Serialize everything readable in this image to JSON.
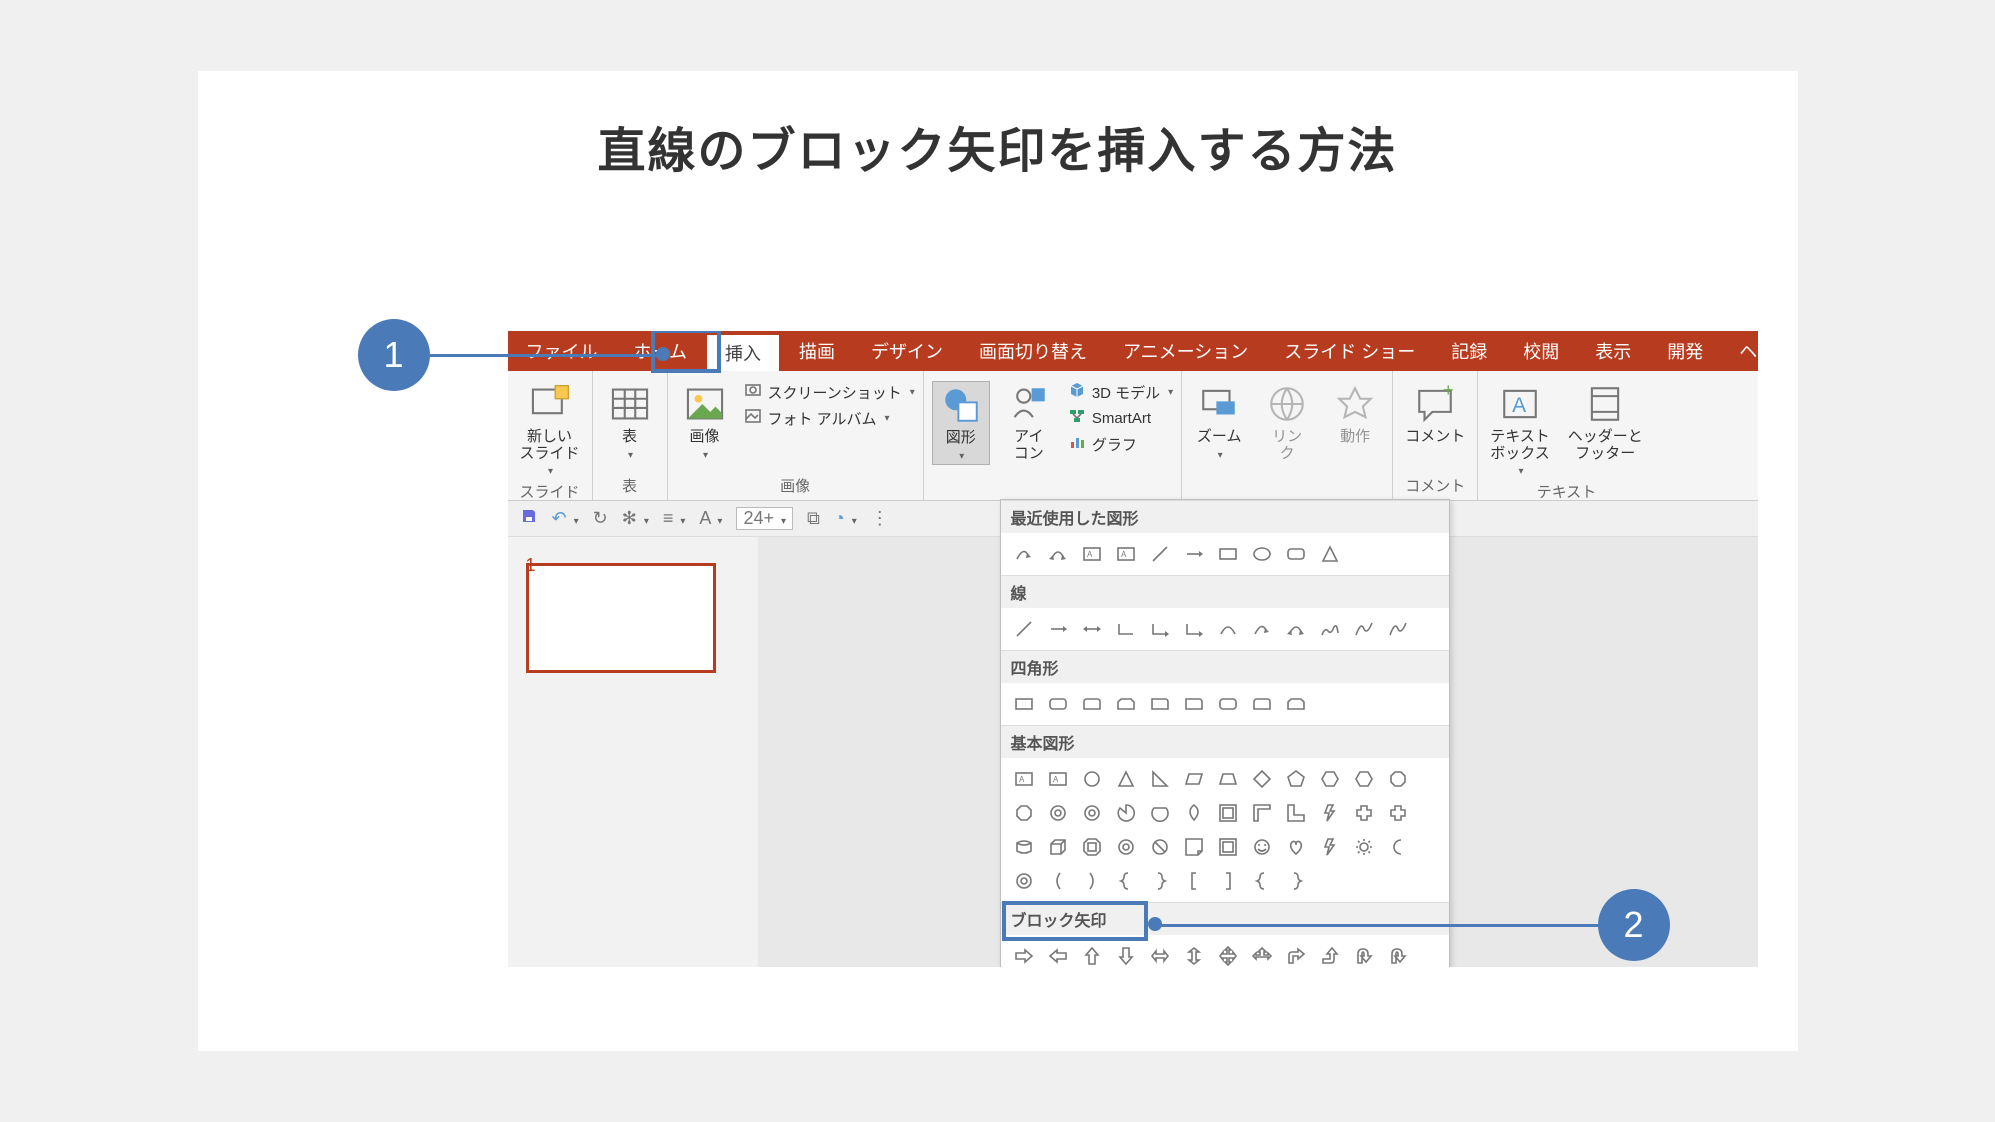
{
  "page_title": "直線のブロック矢印を挿入する方法",
  "callouts": {
    "one": "1",
    "two": "2"
  },
  "tabs": {
    "file": "ファイル",
    "home": "ホーム",
    "insert": "挿入",
    "draw": "描画",
    "design": "デザイン",
    "transitions": "画面切り替え",
    "animations": "アニメーション",
    "slideshow": "スライド ショー",
    "record": "記録",
    "review": "校閲",
    "view": "表示",
    "developer": "開発",
    "help": "ヘルプ"
  },
  "ribbon": {
    "new_slide": "新しい\nスライド",
    "table": "表",
    "images_btn": "画像",
    "screenshot": "スクリーンショット",
    "photoalbum": "フォト アルバム",
    "shapes": "図形",
    "icons": "アイ\nコン",
    "threeD": "3D モデル",
    "smartart": "SmartArt",
    "chart": "グラフ",
    "zoom": "ズーム",
    "link": "リン\nク",
    "action": "動作",
    "comment": "コメント",
    "textbox": "テキスト\nボックス",
    "headerfooter": "ヘッダーと\nフッター",
    "groups": {
      "slides": "スライド",
      "tables": "表",
      "images": "画像",
      "comments": "コメント",
      "text": "テキスト"
    }
  },
  "qat": {
    "fontsize_placeholder": "24+"
  },
  "thumb": {
    "num": "1"
  },
  "shapes_dd": {
    "recent": "最近使用した図形",
    "lines": "線",
    "rectangles": "四角形",
    "basic": "基本図形",
    "block_arrows": "ブロック矢印"
  }
}
